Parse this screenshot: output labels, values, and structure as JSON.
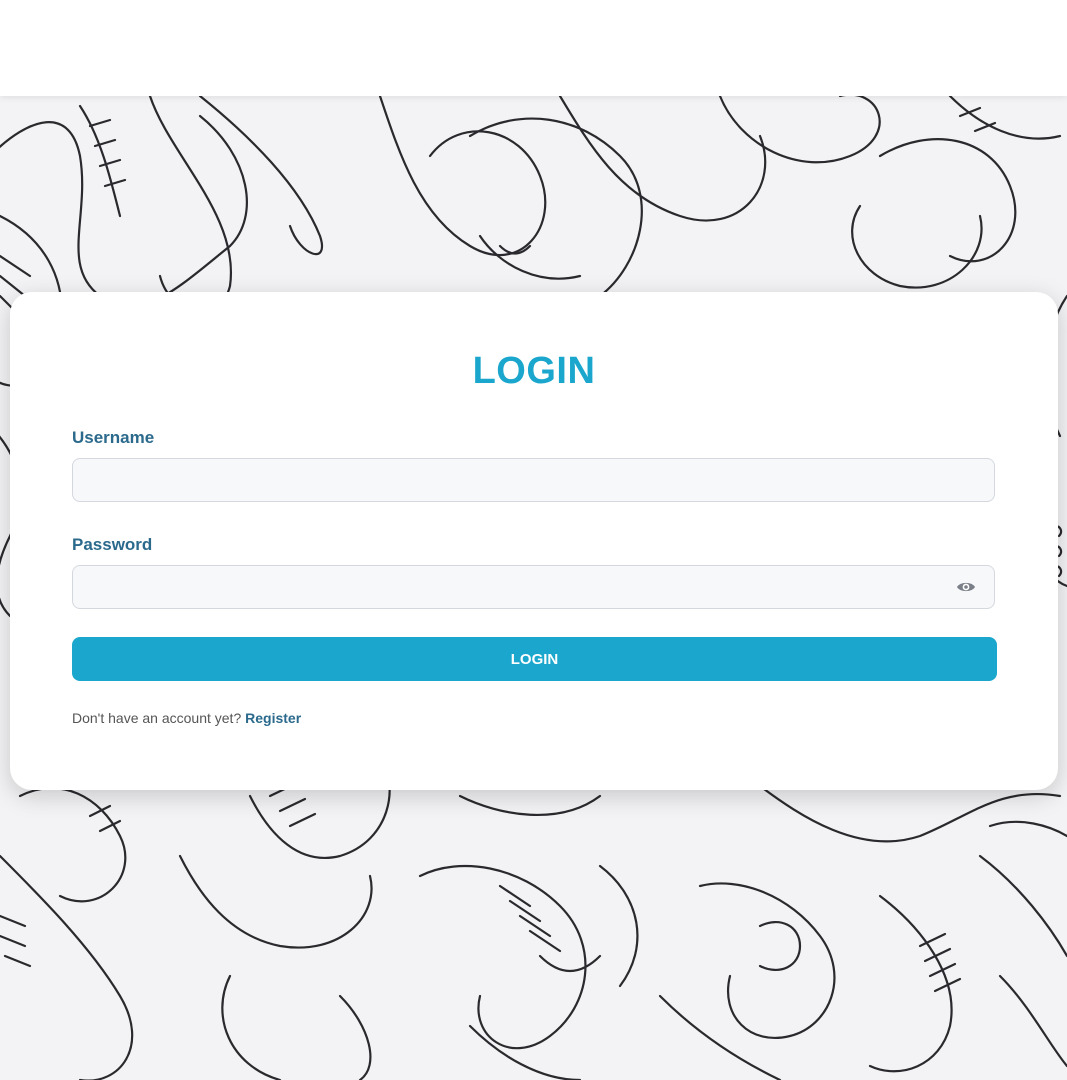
{
  "login": {
    "title": "LOGIN",
    "username_label": "Username",
    "username_value": "",
    "password_label": "Password",
    "password_value": "",
    "submit_label": "LOGIN",
    "register_prompt": "Don't have an account yet?",
    "register_link": "Register"
  },
  "icons": {
    "password_toggle": "eye-icon"
  },
  "colors": {
    "accent": "#1ba7cd",
    "label": "#2b6a8c",
    "card_bg": "#ffffff",
    "input_bg": "#f7f8fa",
    "pattern_stroke": "#2a2a2e"
  }
}
